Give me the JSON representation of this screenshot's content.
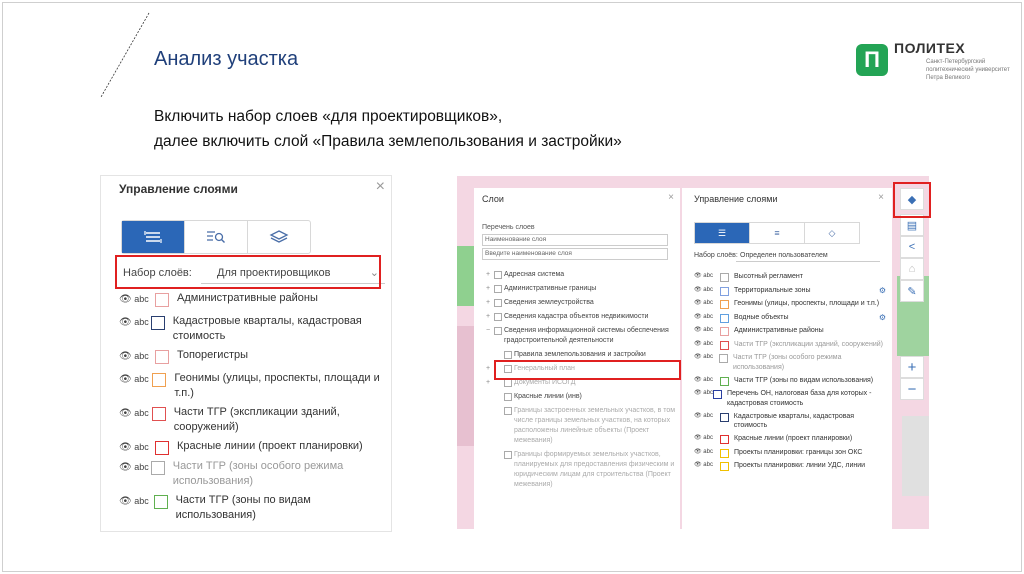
{
  "slide": {
    "title": "Анализ участка",
    "logo": {
      "name": "ПОЛИТЕХ",
      "mark": "П",
      "subtitle": "Санкт-Петербургский политехнический университет Петра Великого"
    },
    "instructions": [
      "Включить набор слоев «для проектировщиков»,",
      "далее включить слой «Правила землепользования и застройки»"
    ]
  },
  "left_panel": {
    "title": "Управление слоями",
    "close": "×",
    "set_label": "Набор слоёв:",
    "set_value": "Для проектировщиков",
    "layers": [
      {
        "ctl": "abc",
        "text": "Административные районы",
        "swatch": "#e8a0a0",
        "dim": false
      },
      {
        "ctl": "abc",
        "text": "Кадастровые кварталы, кадастровая стоимость",
        "swatch": "#2a3f70",
        "dim": false
      },
      {
        "ctl": "abc",
        "text": "Топорегистры",
        "swatch": "#e8a0a0",
        "dim": false
      },
      {
        "ctl": "abc",
        "text": "Геонимы (улицы, проспекты, площади и т.п.)",
        "swatch": "#f0a050",
        "dim": false
      },
      {
        "ctl": "abc",
        "text": "Части ТГР (экспликации зданий, сооружений)",
        "swatch": "#e05050",
        "dim": false
      },
      {
        "ctl": "abc",
        "text": "Красные линии (проект планировки)",
        "swatch": "#e03030",
        "dim": false
      },
      {
        "ctl": "abc",
        "text": "Части ТГР (зоны особого режима использования)",
        "swatch": "#aaaaaa",
        "dim": true
      },
      {
        "ctl": "abc",
        "text": "Части ТГР (зоны по видам использования)",
        "swatch": "#60b050",
        "dim": false
      }
    ]
  },
  "layers_panel": {
    "title": "Слои",
    "close": "×",
    "list_label": "Перечень слоев",
    "select_value": "Наименование слоя",
    "search_placeholder": "Введите наименование слоя",
    "tree": [
      {
        "pm": "+",
        "text": "Адресная система",
        "level": 0,
        "dim": false
      },
      {
        "pm": "+",
        "text": "Административные границы",
        "level": 0,
        "dim": false
      },
      {
        "pm": "+",
        "text": "Сведения землеустройства",
        "level": 0,
        "dim": false
      },
      {
        "pm": "+",
        "text": "Сведения кадастра объектов недвижимости",
        "level": 0,
        "dim": false
      },
      {
        "pm": "−",
        "text": "Сведения информационной системы обеспечения градостроительной деятельности",
        "level": 0,
        "dim": false
      },
      {
        "pm": "",
        "text": "Правила землепользования и застройки",
        "level": 1,
        "dim": false
      },
      {
        "pm": "+",
        "text": "Генеральный план",
        "level": 1,
        "dim": true
      },
      {
        "pm": "+",
        "text": "Документы ИСОГД",
        "level": 1,
        "dim": true
      },
      {
        "pm": "",
        "text": "Красные линии (инв)",
        "level": 1,
        "dim": false
      },
      {
        "pm": "",
        "text": "Границы застроенных земельных участков, в том числе границы земельных участков, на которых расположены линейные объекты (Проект межевания)",
        "level": 1,
        "dim": true
      },
      {
        "pm": "",
        "text": "Границы формируемых земельных участков, планируемых для предоставления физическим и юридическим лицам для строительства (Проект межевания)",
        "level": 1,
        "dim": true
      }
    ]
  },
  "control_panel": {
    "title": "Управление слоями",
    "close": "×",
    "set_label": "Набор слоёв:",
    "set_value": "Определен пользователем",
    "layers": [
      {
        "text": "Высотный регламент",
        "swatch": "#aaaaaa",
        "gear": false,
        "dim": false
      },
      {
        "text": "Территориальные зоны",
        "swatch": "#80a0e0",
        "gear": true,
        "dim": false
      },
      {
        "text": "Геонимы (улицы, проспекты, площади и т.п.)",
        "swatch": "#f0a050",
        "gear": false,
        "dim": false
      },
      {
        "text": "Водные объекты",
        "swatch": "#60a0e0",
        "gear": true,
        "dim": false
      },
      {
        "text": "Административные районы",
        "swatch": "#e8a0a0",
        "gear": false,
        "dim": false
      },
      {
        "text": "Части ТГР (экспликации зданий, сооружений)",
        "swatch": "#e05050",
        "gear": false,
        "dim": true
      },
      {
        "text": "Части ТГР (зоны особого режима использования)",
        "swatch": "#aaaaaa",
        "gear": false,
        "dim": true
      },
      {
        "text": "Части ТГР (зоны по видам использования)",
        "swatch": "#60b050",
        "gear": false,
        "dim": false
      },
      {
        "text": "Перечень ОН, налоговая база для которых - кадастровая стоимость",
        "swatch": "#2a3fa0",
        "gear": false,
        "dim": false
      },
      {
        "text": "Кадастровые кварталы, кадастровая стоимость",
        "swatch": "#2a3f70",
        "gear": false,
        "dim": false
      },
      {
        "text": "Красные линии (проект планировки)",
        "swatch": "#e03030",
        "gear": false,
        "dim": false
      },
      {
        "text": "Проекты планировки: границы зон ОКС",
        "swatch": "#f0c000",
        "gear": false,
        "dim": false
      },
      {
        "text": "Проекты планировки: линии УДС, линии",
        "swatch": "#f0c000",
        "gear": false,
        "dim": false
      }
    ]
  },
  "colors": {
    "accent": "#2b67b7",
    "highlight": "#e02020",
    "title": "#1f3f7a",
    "logo": "#23a455",
    "map": "#f4d7e3"
  },
  "icons": {
    "left_tabs": [
      "list-icon",
      "search-layers-icon",
      "layers-icon"
    ],
    "map_tools": [
      "layers-icon",
      "print-icon",
      "share-icon",
      "home-icon",
      "ruler-icon",
      "zoom-in-icon",
      "zoom-out-icon"
    ]
  }
}
